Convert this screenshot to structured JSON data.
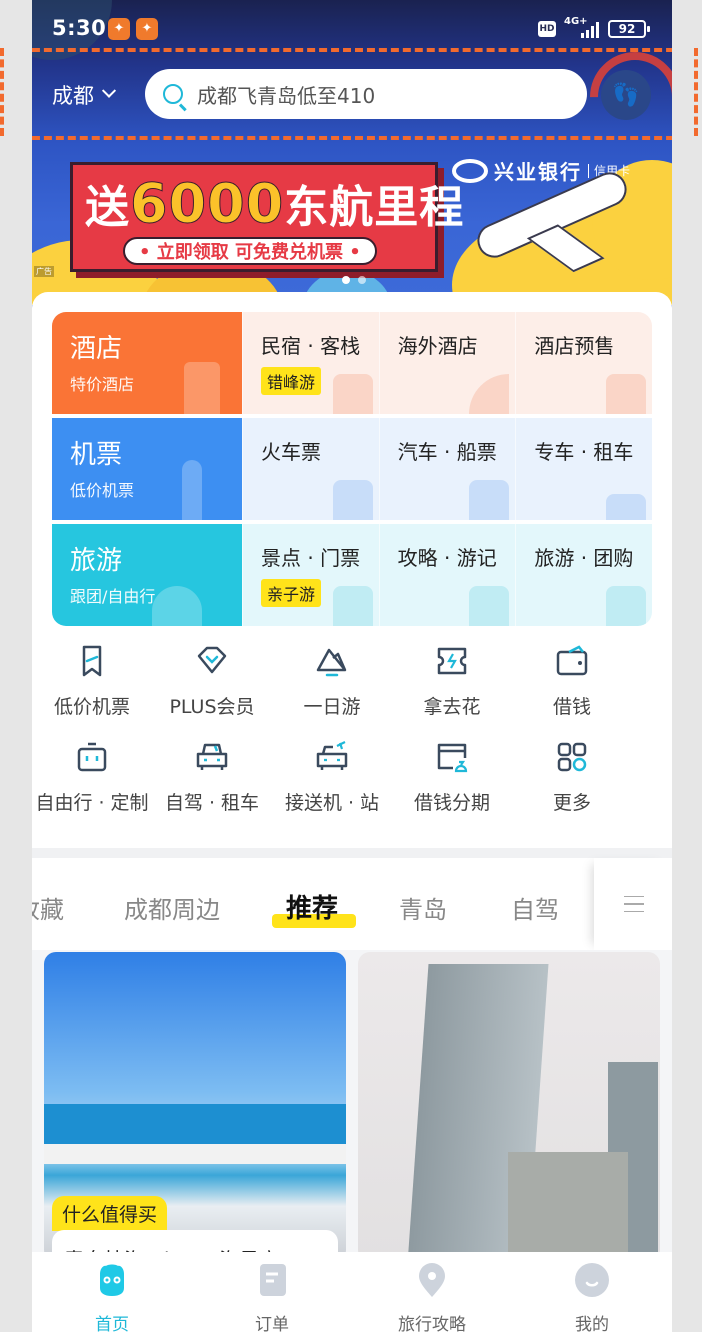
{
  "status_bar": {
    "time": "5:30",
    "network": "4G+",
    "hd": "HD",
    "battery": "92"
  },
  "header": {
    "city": "成都",
    "search_placeholder": "成都飞青岛低至410"
  },
  "banner": {
    "title_prefix": "送",
    "title_number": "6000",
    "title_suffix": "东航里程",
    "subtitle": "• 立即领取  可免费兑机票 •",
    "bank_name": "兴业银行",
    "bank_card": "信用卡",
    "ad_label": "广告",
    "slide_count": 2,
    "active_slide": 1
  },
  "service_grid": [
    {
      "main": {
        "title": "酒店",
        "subtitle": "特价酒店",
        "color": "#fa7436"
      },
      "subs": [
        {
          "label": "民宿 · 客栈",
          "tag": "错峰游"
        },
        {
          "label": "海外酒店"
        },
        {
          "label": "酒店预售"
        }
      ],
      "sub_bg": "#fdeee8"
    },
    {
      "main": {
        "title": "机票",
        "subtitle": "低价机票",
        "color": "#3d8ff2"
      },
      "subs": [
        {
          "label": "火车票"
        },
        {
          "label": "汽车 · 船票"
        },
        {
          "label": "专车 · 租车"
        }
      ],
      "sub_bg": "#e9f2fd"
    },
    {
      "main": {
        "title": "旅游",
        "subtitle": "跟团/自由行",
        "color": "#26c6df"
      },
      "subs": [
        {
          "label": "景点 · 门票",
          "tag": "亲子游"
        },
        {
          "label": "攻略 · 游记"
        },
        {
          "label": "旅游 · 团购"
        }
      ],
      "sub_bg": "#e3f7fb"
    }
  ],
  "quick_icons": [
    [
      {
        "label": "低价机票",
        "icon": "flight-ticket-icon"
      },
      {
        "label": "PLUS会员",
        "icon": "diamond-icon"
      },
      {
        "label": "一日游",
        "icon": "mountain-icon"
      },
      {
        "label": "拿去花",
        "icon": "coupon-icon"
      },
      {
        "label": "借钱",
        "icon": "wallet-icon"
      }
    ],
    [
      {
        "label": "自由行 · 定制",
        "icon": "suitcase-icon"
      },
      {
        "label": "自驾 · 租车",
        "icon": "car-icon"
      },
      {
        "label": "接送机 · 站",
        "icon": "airport-car-icon"
      },
      {
        "label": "借钱分期",
        "icon": "installment-icon"
      },
      {
        "label": "更多",
        "icon": "more-grid-icon"
      }
    ]
  ],
  "feed_tabs": {
    "items": [
      "收藏",
      "成都周边",
      "推荐",
      "青岛",
      "自驾"
    ],
    "active": "推荐"
  },
  "feed": [
    {
      "tag": "什么值得买",
      "title": "青岛枝海一katex海景房"
    },
    {
      "tag": "",
      "title": ""
    }
  ],
  "bottom_nav": [
    {
      "label": "首页",
      "icon": "home-mascot-icon",
      "active": true
    },
    {
      "label": "订单",
      "icon": "order-icon",
      "active": false
    },
    {
      "label": "旅行攻略",
      "icon": "location-pin-icon",
      "active": false
    },
    {
      "label": "我的",
      "icon": "profile-icon",
      "active": false
    }
  ],
  "colors": {
    "accent": "#1fb8d8",
    "tag_yellow": "#ffe31a",
    "highlight_frame": "#f26a2e"
  }
}
